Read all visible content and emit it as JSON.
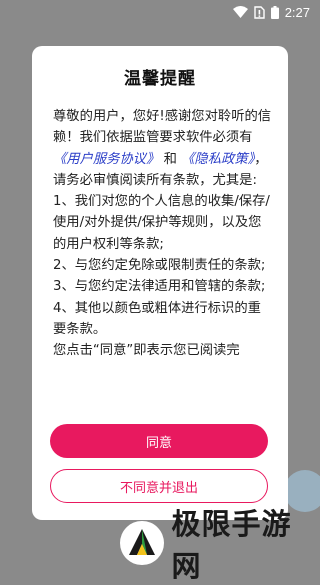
{
  "status_bar": {
    "time": "2:27"
  },
  "dialog": {
    "title": "温馨提醒",
    "body": {
      "intro_text": "尊敬的用户，您好!感谢您对聆听的信赖！我们依据监管要求软件必须有",
      "user_agreement_link": "《用户服务协议》",
      "and_text": "和",
      "privacy_policy_link": "《隐私政策》",
      "after_links_text": "，请务必审慎阅读所有条款，尤其是:",
      "items": [
        "1、我们对您的个人信息的收集/保存/使用/对外提供/保护等规则，以及您的用户权利等条款;",
        "2、与您约定免除或限制责任的条款;",
        "3、与您约定法律适用和管辖的条款;",
        "4、其他以颜色或粗体进行标识的重要条款。"
      ],
      "trailing_text": "您点击“同意”即表示您已阅读完"
    },
    "agree_label": "同意",
    "decline_label": "不同意并退出"
  },
  "watermark": {
    "text": "极限手游网"
  },
  "colors": {
    "accent": "#e8195f",
    "link": "#2c3fc8",
    "overlay": "#8a8a8a"
  }
}
